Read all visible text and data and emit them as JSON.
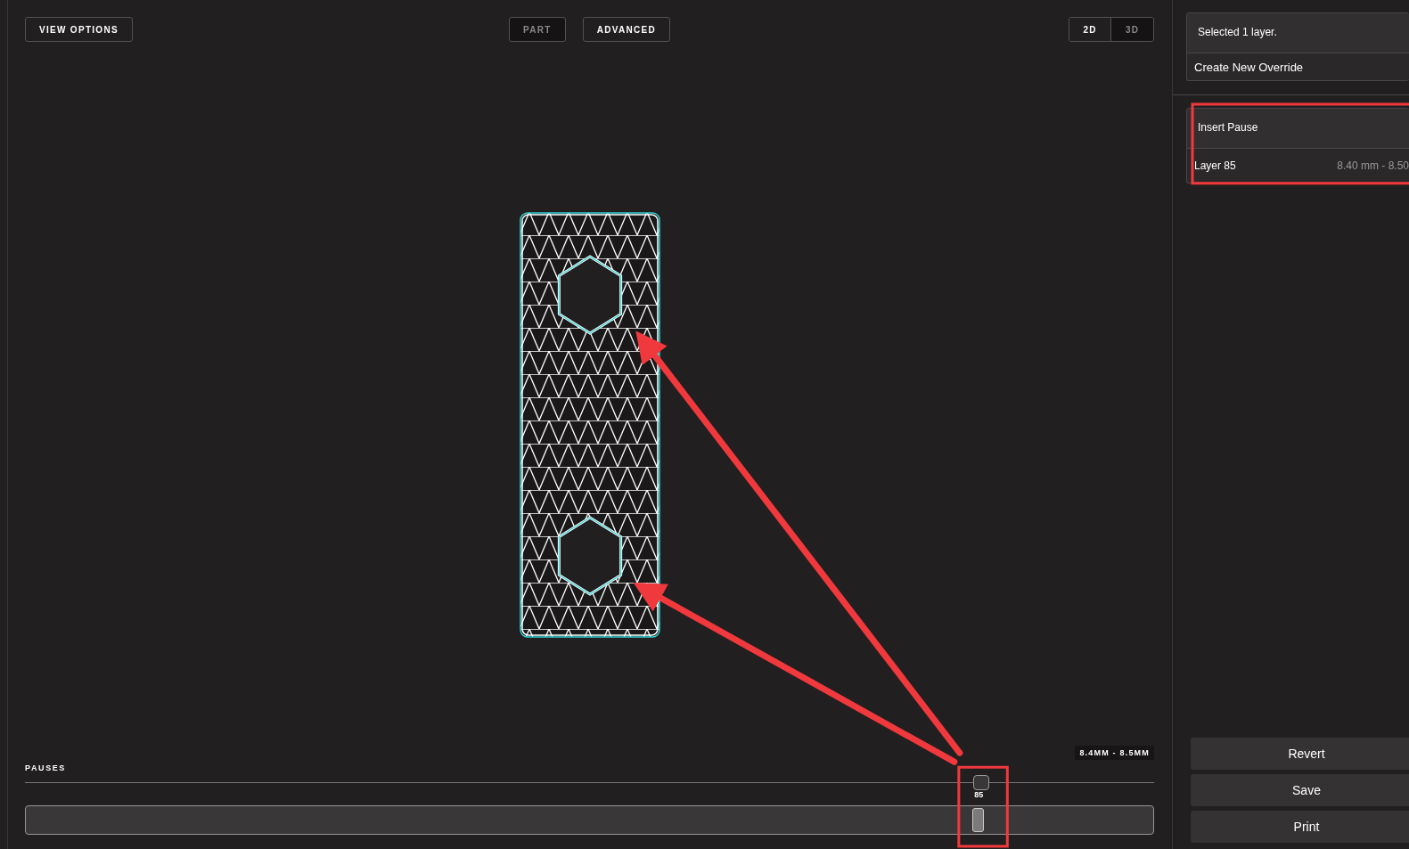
{
  "toolbar": {
    "view_options": "VIEW OPTIONS",
    "modes": [
      {
        "label": "PART",
        "selected": false
      },
      {
        "label": "ADVANCED",
        "selected": true
      }
    ],
    "views": [
      {
        "label": "2D",
        "selected": true
      },
      {
        "label": "3D",
        "selected": false
      }
    ]
  },
  "range_badge": "8.4MM - 8.5MM",
  "pauses": {
    "title": "PAUSES",
    "marker_label": "85",
    "level": 0.844
  },
  "sidebar": {
    "selection": {
      "title": "Selected 1 layer.",
      "action": "Create New Override"
    },
    "pause": {
      "title": "Insert Pause",
      "layer": "Layer 85",
      "range": "8.40 mm - 8.50"
    },
    "buttons": [
      "Revert",
      "Save",
      "Print"
    ]
  }
}
